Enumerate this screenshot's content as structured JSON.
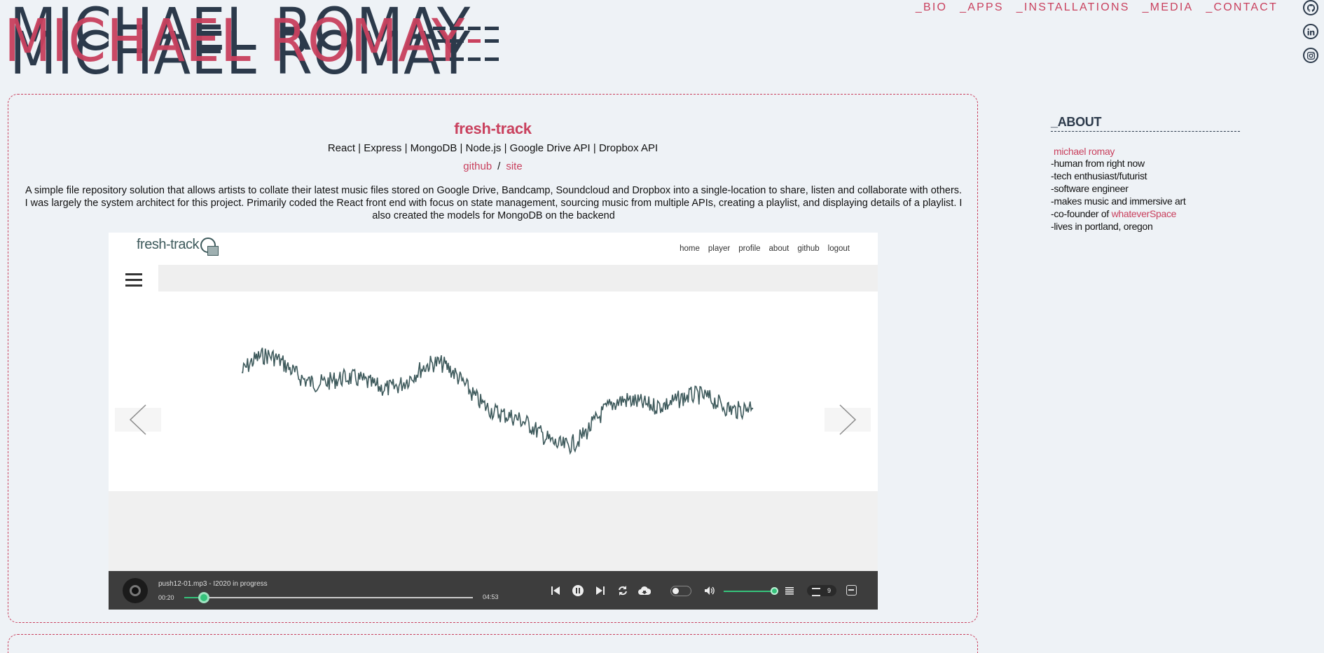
{
  "logo": {
    "text": "MICHAEL ROMAY",
    "colors": {
      "dark": "#2c3a4b",
      "accent": "#c9415e"
    }
  },
  "nav": {
    "items": [
      "_BIO",
      "_APPS",
      "_INSTALLATIONS",
      "_MEDIA",
      "_CONTACT"
    ]
  },
  "social": {
    "icons": [
      "github-icon",
      "linkedin-icon",
      "instagram-icon"
    ]
  },
  "project": {
    "title": "fresh-track",
    "stack": "React | Express | MongoDB | Node.js | Google Drive API | Dropbox API",
    "link_github": "github",
    "link_sep": "/",
    "link_site": "site",
    "description": "A simple file repository solution that allows artists to collate their latest music files stored on Google Drive, Bandcamp, Soundcloud and Dropbox into a single-location to share, listen and collaborate with others. I was largely the system architect for this project. Primarily coded the React front end with focus on state management, sourcing music from multiple APIs, creating a playlist, and displaying details of a playlist. I also created the models for MongoDB on the backend"
  },
  "app_screenshot": {
    "logo": "fresh-track",
    "nav": [
      "home",
      "player",
      "profile",
      "about",
      "github",
      "logout"
    ],
    "player": {
      "track_name": "push12-01.mp3 - I2020 in progress",
      "time_current": "00:20",
      "time_total": "04:53",
      "progress_fraction": 0.068,
      "volume_fraction": 1.0,
      "queue_count": "9",
      "accent_color": "#35c37b"
    }
  },
  "about": {
    "heading": "_ABOUT",
    "name": "michael romay",
    "lines": [
      "-human from right now",
      "-tech enthusiast/futurist",
      "-software engineer",
      "-makes music and immersive art"
    ],
    "cofounder_prefix": "-co-founder of ",
    "cofounder_link": "whateverSpace",
    "last_line": "-lives in portland, oregon"
  }
}
